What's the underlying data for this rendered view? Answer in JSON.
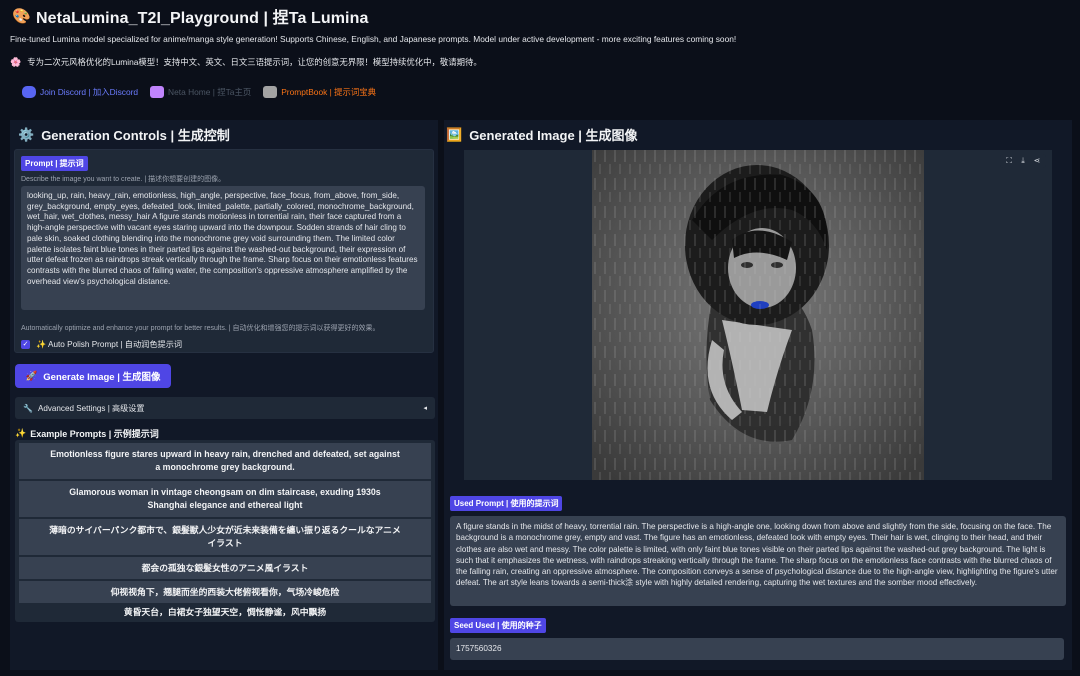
{
  "header": {
    "title": "NetaLumina_T2I_Playground | 捏Ta Lumina",
    "desc_en": "Fine-tuned Lumina model specialized for anime/manga style generation! Supports Chinese, English, and Japanese prompts. Model under active development - more exciting features coming soon!",
    "desc_zh": "专为二次元风格优化的Lumina模型！支持中文、英文、日文三语提示词，让您的创意无界限！模型持续优化中，敬请期待。",
    "links": [
      {
        "label": "Join Discord | 加入Discord",
        "icon": "discord-icon"
      },
      {
        "label": "Neta Home | 捏Ta主页",
        "icon": "neta-icon"
      },
      {
        "label": "PromptBook | 提示词宝典",
        "icon": "book-icon"
      }
    ]
  },
  "controls": {
    "heading": "Generation Controls | 生成控制",
    "prompt_tag": "Prompt | 提示词",
    "prompt_hint": "Describe the image you want to create. | 描述你想要创建的图像。",
    "prompt_value": "looking_up, rain, heavy_rain, emotionless, high_angle, perspective, face_focus, from_above, from_side, grey_background, empty_eyes, defeated_look, limited_palette, partially_colored, monochrome_background, wet_hair, wet_clothes, messy_hair A figure stands motionless in torrential rain, their face captured from a high-angle perspective with vacant eyes staring upward into the downpour. Sodden strands of hair cling to pale skin, soaked clothing blending into the monochrome grey void surrounding them. The limited color palette isolates faint blue tones in their parted lips against the washed-out background, their expression of utter defeat frozen as raindrops streak vertically through the frame. Sharp focus on their emotionless features contrasts with the blurred chaos of falling water, the composition's oppressive atmosphere amplified by the overhead view's psychological distance.",
    "polish_hint": "Automatically optimize and enhance your prompt for better results. | 自动优化和增强您的提示词以获得更好的效果。",
    "polish_label": "✨ Auto Polish Prompt | 自动润色提示词",
    "generate_label": "Generate Image | 生成图像",
    "advanced_label": "Advanced Settings | 高级设置",
    "examples_heading": "Example Prompts | 示例提示词",
    "examples": [
      "Emotionless figure stares upward in heavy rain, drenched and defeated, set against a monochrome grey background.",
      "Glamorous woman in vintage cheongsam on dim staircase, exuding 1930s Shanghai elegance and ethereal light",
      "薄暗のサイバーパンク都市で、銀髪獣人少女が近未来装備を纏い振り返るクールなアニメイラスト",
      "都会の孤独な銀髪女性のアニメ風イラスト",
      "仰视视角下，翘腿而坐的西装大佬俯视看你，气场冷峻危险",
      "黄昏天台，白裙女子独望天空，惆怅静谧，风中飘扬"
    ]
  },
  "output": {
    "heading": "Generated Image | 生成图像",
    "used_prompt_tag": "Used Prompt | 使用的提示词",
    "used_prompt": "A figure stands in the midst of heavy, torrential rain. The perspective is a high-angle one, looking down from above and slightly from the side, focusing on the face. The background is a monochrome grey, empty and vast. The figure has an emotionless, defeated look with empty eyes. Their hair is wet, clinging to their head, and their clothes are also wet and messy. The color palette is limited, with only faint blue tones visible on their parted lips against the washed-out grey background. The light is such that it emphasizes the wetness, with raindrops streaking vertically through the frame. The sharp focus on the emotionless face contrasts with the blurred chaos of the falling rain, creating an oppressive atmosphere. The composition conveys a sense of psychological distance due to the high-angle view, highlighting the figure's utter defeat. The art style leans towards a semi-thick涂 style with highly detailed rendering, capturing the wet textures and the somber mood effectively.",
    "seed_tag": "Seed Used | 使用的种子",
    "seed_value": "1757560326"
  }
}
